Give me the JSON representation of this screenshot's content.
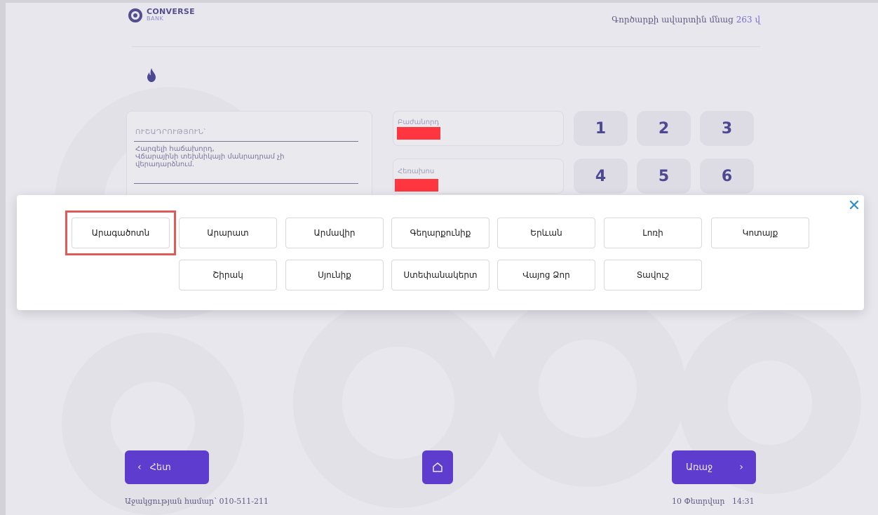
{
  "header": {
    "logo_title": "CONVERSE",
    "logo_subtitle": "BANK",
    "timer_text": "Գործարքի ավարտին մնաց",
    "timer_seconds": "263 վ"
  },
  "form": {
    "section_title": "ՈՒՇԱԴՐՈՒԹՅՈՒՆ՝",
    "notice_text": "Հարգելի հաճախորդ,\nՎճարայինի տեխնիկայի մանրադրամ չի\nվերադարձնում.",
    "field_1_label": "Բաժանորդ",
    "field_2_label": "Հեռախոս"
  },
  "keypad": [
    "1",
    "2",
    "3",
    "4",
    "5",
    "6"
  ],
  "modal": {
    "close_icon": "close-icon",
    "row1": [
      "Արագածոտն",
      "Արարատ",
      "Արմավիր",
      "Գեղարքունիք",
      "Երևան",
      "Լոռի",
      "Կոտայք"
    ],
    "row2": [
      "Շիրակ",
      "Սյունիք",
      "Ստեփանակերտ",
      "Վայոց Ձոր",
      "Տավուշ"
    ],
    "selected": "Արագածոտն"
  },
  "nav": {
    "back_label": "Հետ",
    "next_label": "Առաջ",
    "home_icon": "home-icon"
  },
  "footer": {
    "support_label": "Աջակցության համար՝ 010-511-211",
    "datetime": "10 Փետրվար   14:31"
  },
  "colors": {
    "accent": "#3a12c4",
    "brand": "#2e2878",
    "close": "#2d8fc9",
    "highlight": "#e05a5a",
    "redacted": "#ff0a16"
  }
}
